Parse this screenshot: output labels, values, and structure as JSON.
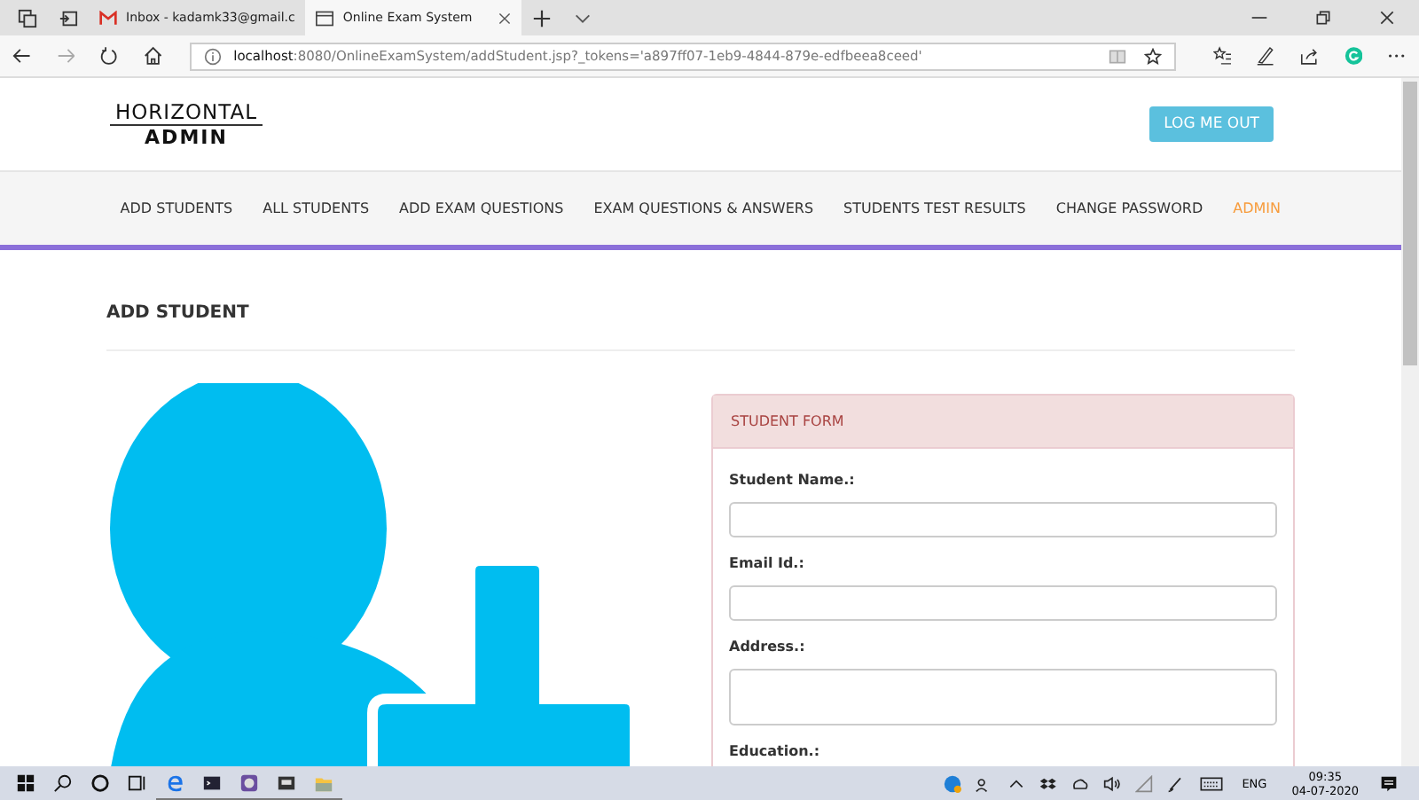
{
  "browser": {
    "tabs": [
      {
        "title": "Inbox - kadamk33@gmail.c",
        "kind": "mail",
        "selected": false
      },
      {
        "title": "Online Exam System",
        "kind": "page",
        "selected": true
      }
    ],
    "address_host": "localhost",
    "address_rest": ":8080/OnlineExamSystem/addStudent.jsp?_tokens='a897ff07-1eb9-4844-879e-edfbeea8ceed'"
  },
  "header": {
    "logo_top": "HORIZONTAL",
    "logo_bottom": "ADMIN",
    "logout": "LOG ME OUT"
  },
  "nav": [
    {
      "label": "ADD STUDENTS",
      "selected": false
    },
    {
      "label": "ALL STUDENTS",
      "selected": false
    },
    {
      "label": "ADD EXAM QUESTIONS",
      "selected": false
    },
    {
      "label": "EXAM QUESTIONS & ANSWERS",
      "selected": false
    },
    {
      "label": "STUDENTS TEST RESULTS",
      "selected": false
    },
    {
      "label": "CHANGE PASSWORD",
      "selected": false
    },
    {
      "label": "ADMIN",
      "selected": true
    }
  ],
  "page_title": "ADD STUDENT",
  "form": {
    "title": "STUDENT FORM",
    "fields": [
      {
        "label": "Student Name.:",
        "kind": "line"
      },
      {
        "label": "Email Id.:",
        "kind": "line"
      },
      {
        "label": "Address.:",
        "kind": "area"
      },
      {
        "label": "Education.:",
        "kind": "hidden"
      }
    ]
  },
  "taskbar": {
    "lang": "ENG",
    "time": "09:35",
    "date": "04-07-2020"
  }
}
